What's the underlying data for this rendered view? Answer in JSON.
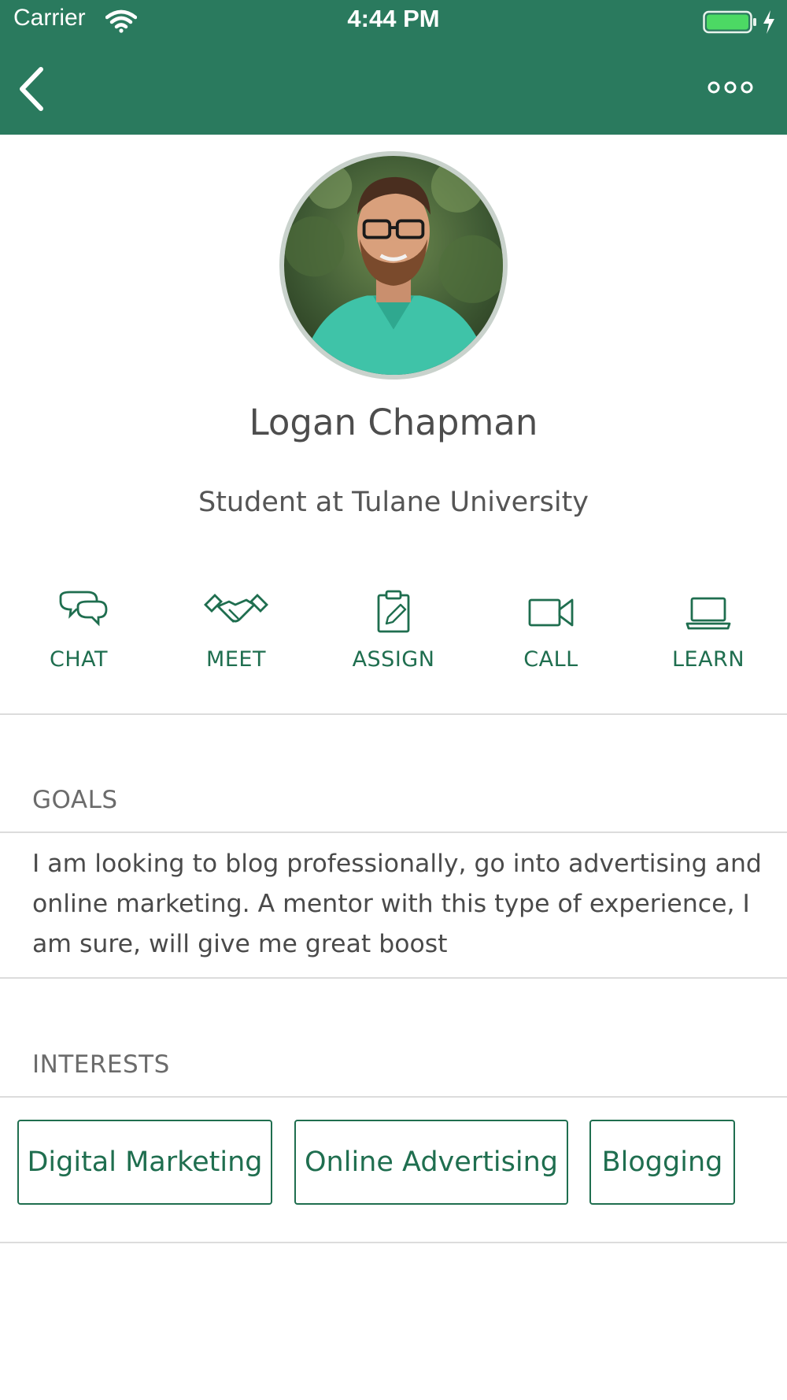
{
  "status_bar": {
    "carrier": "Carrier",
    "time": "4:44 PM",
    "wifi_icon": "wifi-icon",
    "battery_icon": "battery-full-icon",
    "charging_icon": "bolt-icon",
    "battery_color": "#4cd964"
  },
  "nav_bar": {
    "back_icon": "chevron-left-icon",
    "more_icon": "more-horizontal-icon",
    "background_color": "#2a7a5e"
  },
  "profile": {
    "name": "Logan Chapman",
    "subtitle": "Student at Tulane University",
    "avatar": "profile-photo"
  },
  "actions": [
    {
      "label": "CHAT",
      "icon": "chat-bubbles-icon"
    },
    {
      "label": "MEET",
      "icon": "handshake-icon"
    },
    {
      "label": "ASSIGN",
      "icon": "clipboard-pencil-icon"
    },
    {
      "label": "CALL",
      "icon": "video-camera-icon"
    },
    {
      "label": "LEARN",
      "icon": "laptop-icon"
    }
  ],
  "goals": {
    "heading": "GOALS",
    "text": "I am looking to blog professionally, go into advertising and online marketing. A mentor with this type of experience, I am sure, will give me great boost"
  },
  "interests": {
    "heading": "INTERESTS",
    "tags": [
      "Digital Marketing",
      "Online Advertising",
      "Blogging"
    ]
  },
  "accent_color": "#1f6e4f"
}
